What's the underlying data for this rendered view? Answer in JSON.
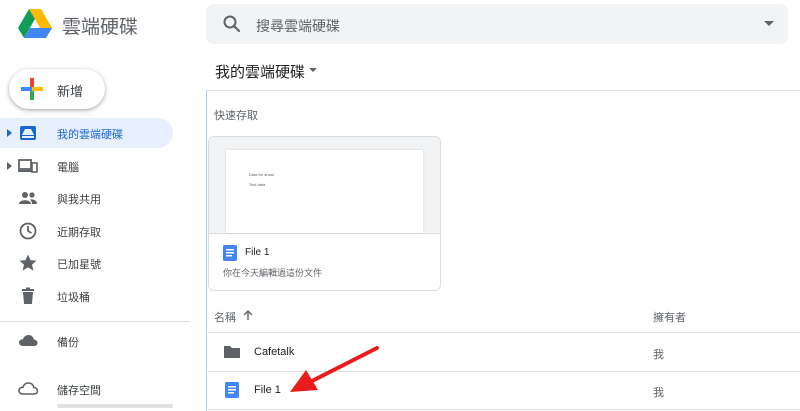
{
  "header": {
    "app_name": "雲端硬碟",
    "search_placeholder": "搜尋雲端硬碟"
  },
  "new_button": {
    "label": "新增"
  },
  "sidebar": {
    "items": [
      {
        "label": "我的雲端硬碟",
        "icon": "drive-icon",
        "active": true
      },
      {
        "label": "電腦",
        "icon": "computer-icon"
      },
      {
        "label": "與我共用",
        "icon": "people-icon"
      },
      {
        "label": "近期存取",
        "icon": "clock-icon"
      },
      {
        "label": "已加星號",
        "icon": "star-icon"
      },
      {
        "label": "垃圾桶",
        "icon": "trash-icon"
      },
      {
        "label": "備份",
        "icon": "cloud-icon"
      },
      {
        "label": "儲存空間",
        "icon": "cloud-outline-icon"
      }
    ]
  },
  "main": {
    "title": "我的雲端硬碟",
    "quick_access_title": "快速存取",
    "quick_card": {
      "preview_line1": "Data for share",
      "preview_line2": "Test data",
      "name": "File 1",
      "subtitle": "你在今天編輯過這份文件"
    },
    "list": {
      "col_name": "名稱",
      "col_owner": "擁有者",
      "rows": [
        {
          "name": "Cafetalk",
          "type": "folder",
          "owner": "我"
        },
        {
          "name": "File 1",
          "type": "doc",
          "owner": "我"
        }
      ]
    }
  },
  "colors": {
    "accent": "#1967d2",
    "active_bg": "#e8f0fe",
    "doc_blue": "#4285f4",
    "annotation_red": "#ea1c1c"
  }
}
